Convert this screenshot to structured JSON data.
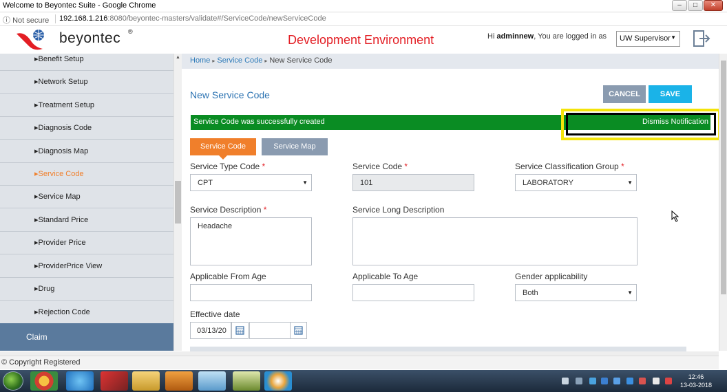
{
  "window": {
    "title": "Welcome to Beyontec Suite - Google Chrome",
    "minimize": "–",
    "maximize": "□",
    "close": "✕"
  },
  "address": {
    "security": "Not secure",
    "host": "192.168.1.216",
    "path": ":8080/beyontec-masters/validate#/ServiceCode/newServiceCode"
  },
  "header": {
    "logo_text": "beyontec",
    "logo_reg": "®",
    "environment": "Development Environment",
    "greeting_prefix": "Hi",
    "username": "adminnew",
    "greeting_suffix": ", You are logged in as",
    "role": "UW Supervisor"
  },
  "sidebar": {
    "items": [
      {
        "label": "▸Benefit Setup"
      },
      {
        "label": "▸Network Setup"
      },
      {
        "label": "▸Treatment Setup"
      },
      {
        "label": "▸Diagnosis Code"
      },
      {
        "label": "▸Diagnosis Map"
      },
      {
        "label": "▸Service Code"
      },
      {
        "label": "▸Service Map"
      },
      {
        "label": "▸Standard Price"
      },
      {
        "label": "▸Provider Price"
      },
      {
        "label": "▸ProviderPrice View"
      },
      {
        "label": "▸Drug"
      },
      {
        "label": "▸Rejection Code"
      }
    ],
    "claim": "Claim"
  },
  "breadcrumb": {
    "home": "Home",
    "service_code": "Service Code",
    "current": "New Service Code"
  },
  "page": {
    "title": "New Service Code",
    "cancel": "CANCEL",
    "save": "SAVE"
  },
  "notification": {
    "message": "Service Code was successfully created",
    "dismiss": "Dismiss Notification"
  },
  "tabs": {
    "service_code": "Service Code",
    "service_map": "Service Map"
  },
  "form": {
    "service_type_label": "Service Type Code",
    "service_type_value": "CPT",
    "service_code_label": "Service Code",
    "service_code_value": "101",
    "classification_label": "Service Classification Group",
    "classification_value": "LABORATORY",
    "description_label": "Service Description",
    "description_value": "Headache",
    "long_description_label": "Service Long Description",
    "long_description_value": "",
    "from_age_label": "Applicable From Age",
    "from_age_value": "",
    "to_age_label": "Applicable To Age",
    "to_age_value": "",
    "gender_label": "Gender applicability",
    "gender_value": "Both",
    "effective_label": "Effective date",
    "effective_from_value": "03/13/20",
    "effective_to_value": "",
    "required_mark": "*"
  },
  "footer": {
    "copyright": "© Copyright Registered"
  },
  "taskbar": {
    "time": "12:46",
    "date": "13-03-2018"
  }
}
